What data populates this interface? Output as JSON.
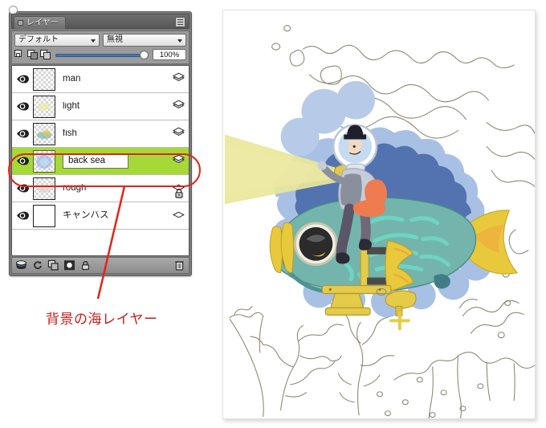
{
  "window": {
    "tab_label": "レイヤー",
    "tab_icon": "square-icon",
    "menu_icon": "panel-menu-icon"
  },
  "controls": {
    "blend_mode": "デフォルト",
    "alpha_mode": "無視",
    "opacity_value": "100%",
    "opacity_percent": 100,
    "lock_icons": [
      "lock-alpha-icon",
      "lock-pixels-icon",
      "lock-position-icon"
    ]
  },
  "layers": [
    {
      "name": "man",
      "visible": true,
      "locked": false,
      "selected": false,
      "editing": false,
      "thumb": "transparent"
    },
    {
      "name": "light",
      "visible": true,
      "locked": false,
      "selected": false,
      "editing": false,
      "thumb": "transparent"
    },
    {
      "name": "fish",
      "visible": true,
      "locked": false,
      "selected": false,
      "editing": false,
      "thumb": "transparent"
    },
    {
      "name": "back sea",
      "visible": true,
      "locked": false,
      "selected": true,
      "editing": true,
      "thumb": "transparent"
    },
    {
      "name": "rough",
      "visible": true,
      "locked": true,
      "selected": false,
      "editing": false,
      "thumb": "transparent"
    },
    {
      "name": "キャンバス",
      "visible": true,
      "locked": false,
      "selected": false,
      "editing": false,
      "thumb": "blank"
    }
  ],
  "toolbar": {
    "buttons": [
      "new-layer-icon",
      "merge-down-icon",
      "duplicate-layer-icon",
      "layer-mask-icon",
      "lock-layer-icon"
    ],
    "delete_button": "trash-icon"
  },
  "annotation": {
    "text": "背景の海レイヤー",
    "color": "#c2211c",
    "highlight_target": "back sea"
  },
  "colors": {
    "selection_green": "#a5d938",
    "annotation_red": "#e2231a",
    "panel_gray": "#9b9b9b",
    "sea_dark_blue": "#5273b0",
    "sea_light_blue": "#a8c0e4",
    "fish_teal": "#73b5ad",
    "fish_yellow": "#e8c93c",
    "light_beam": "#e9e79a",
    "lineart": "#8d8a77"
  },
  "canvas": {
    "title": "mechanical-fish-illustration"
  }
}
